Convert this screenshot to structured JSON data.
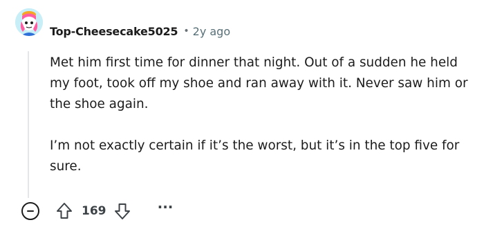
{
  "comment": {
    "author": "Top-Cheesecake5025",
    "separator": "•",
    "age": "2y ago",
    "paragraphs": [
      "Met him first time for dinner that night. Out of a sudden he held my foot, took off my shoe and ran away with it. Never saw him or the shoe again.",
      "I’m not exactly certain if it’s the worst, but it’s in the top five for sure."
    ],
    "score": "169",
    "more_label": "···"
  },
  "icons": {
    "avatar": "avatar-snoo",
    "collapse": "collapse-icon",
    "upvote": "upvote-arrow-icon",
    "downvote": "downvote-arrow-icon",
    "more": "more-options-icon"
  },
  "colors": {
    "text": "#1c1c1c",
    "meta": "#576f76",
    "thread_line": "#e4e6e8",
    "avatar_bg": "#c8eef7"
  }
}
